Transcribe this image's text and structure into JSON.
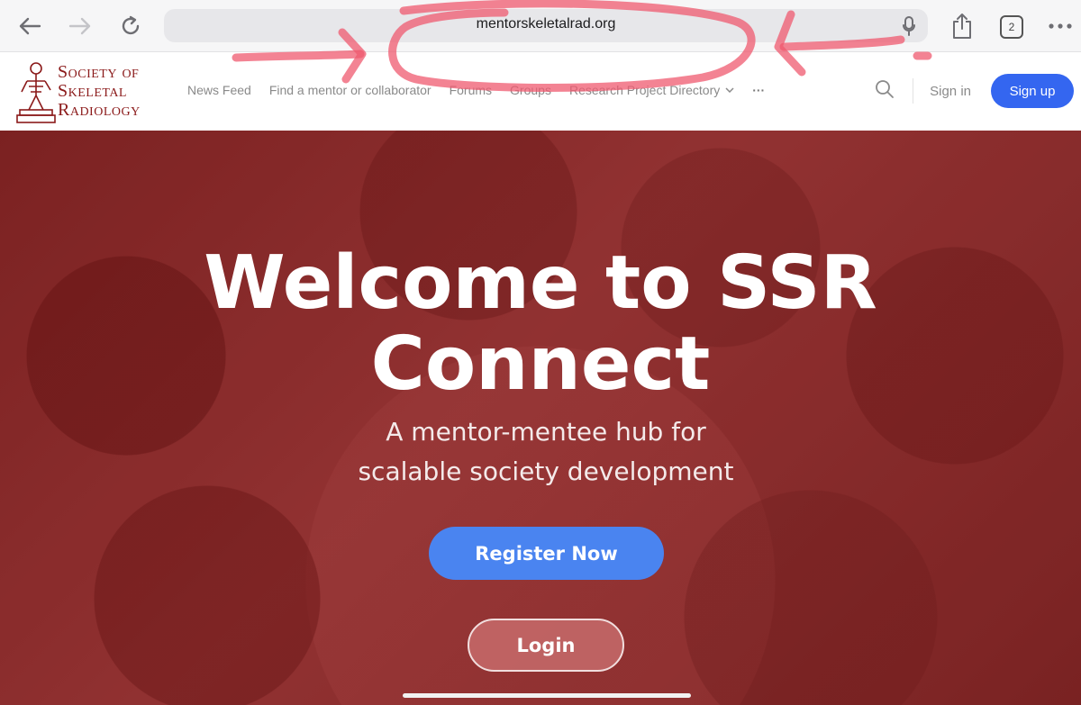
{
  "browser": {
    "url": "mentorskeletalrad.org",
    "tab_count": "2",
    "back_icon": "back-arrow-icon",
    "forward_icon": "forward-arrow-icon",
    "reload_icon": "reload-icon",
    "mic_icon": "microphone-icon",
    "share_icon": "share-icon",
    "more_icon": "more-dots-icon"
  },
  "site": {
    "logo_lines": [
      "Society of",
      "Skeletal",
      "Radiology"
    ],
    "brand_color": "#8b1a1a",
    "nav": [
      {
        "label": "News Feed"
      },
      {
        "label": "Find a mentor or collaborator"
      },
      {
        "label": "Forums"
      },
      {
        "label": "Groups"
      },
      {
        "label": "Research Project Directory"
      }
    ],
    "more_label": "···",
    "signin_label": "Sign in",
    "signup_label": "Sign up",
    "accent_color": "#3466f0"
  },
  "hero": {
    "title_line1": "Welcome to SSR",
    "title_line2": "Connect",
    "subtitle_line1": "A mentor-mentee hub for",
    "subtitle_line2": "scalable society development",
    "register_label": "Register Now",
    "login_label": "Login",
    "register_color": "#4a84f0"
  }
}
